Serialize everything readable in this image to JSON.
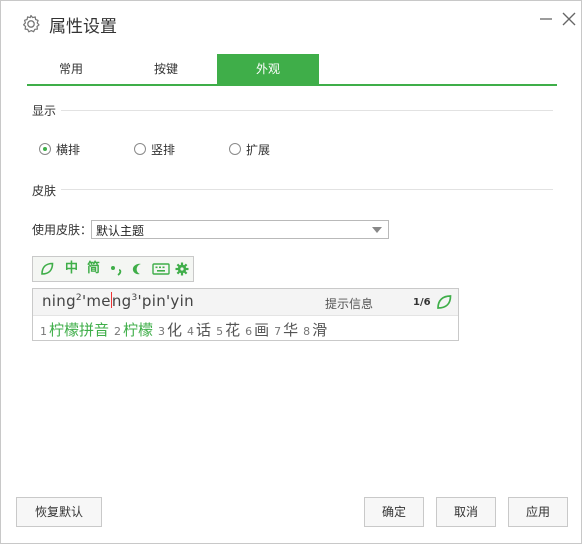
{
  "window": {
    "title": "属性设置"
  },
  "tabs": [
    {
      "label": "常用",
      "active": false
    },
    {
      "label": "按键",
      "active": false
    },
    {
      "label": "外观",
      "active": true
    }
  ],
  "display": {
    "section_label": "显示",
    "options": [
      {
        "label": "横排",
        "checked": true
      },
      {
        "label": "竖排",
        "checked": false
      },
      {
        "label": "扩展",
        "checked": false
      }
    ]
  },
  "skin": {
    "section_label": "皮肤",
    "use_label": "使用皮肤：",
    "selected": "默认主题"
  },
  "preview": {
    "toolbar": {
      "zh": "中",
      "simplified": "简"
    },
    "pinyin_parts": [
      "ning",
      "2",
      "'me",
      "ng",
      "3",
      "'pin'yin"
    ],
    "hint": "提示信息",
    "page": "1/6",
    "candidates": [
      {
        "num": "1",
        "text": "柠檬拼音",
        "highlight": true
      },
      {
        "num": "2",
        "text": "柠檬",
        "highlight": true
      },
      {
        "num": "3",
        "text": "化",
        "highlight": false
      },
      {
        "num": "4",
        "text": "话",
        "highlight": false
      },
      {
        "num": "5",
        "text": "花",
        "highlight": false
      },
      {
        "num": "6",
        "text": "画",
        "highlight": false
      },
      {
        "num": "7",
        "text": "华",
        "highlight": false
      },
      {
        "num": "8",
        "text": "滑",
        "highlight": false
      }
    ]
  },
  "buttons": {
    "restore": "恢复默认",
    "ok": "确定",
    "cancel": "取消",
    "apply": "应用"
  },
  "colors": {
    "accent": "#3fae49"
  }
}
